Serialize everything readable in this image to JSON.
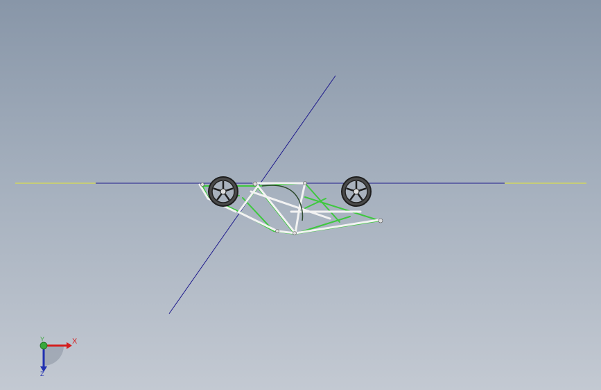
{
  "viewport": {
    "background_top": "#8896a8",
    "background_bottom": "#c3c9d2"
  },
  "model": {
    "frame_color": "#3ec83e",
    "tube_color": "#f2f2f2",
    "wheel_color": "#2a2a2a",
    "sketch_line_color": "#1e1a8c",
    "extension_line_color": "#e8e830"
  },
  "triad": {
    "x_label": "X",
    "y_label": "Y",
    "z_label": "Z",
    "x_color": "#d42020",
    "y_color": "#3aa83a",
    "z_color": "#2030b0"
  }
}
